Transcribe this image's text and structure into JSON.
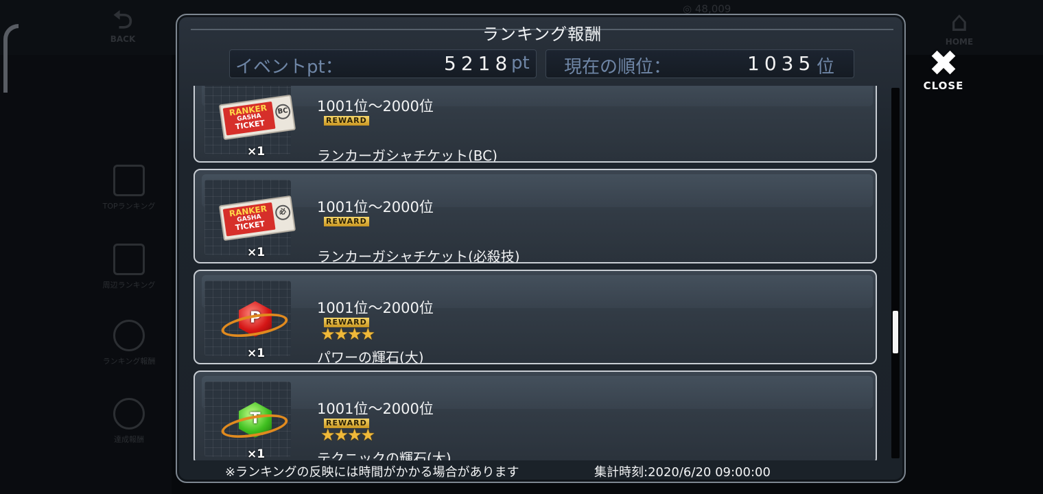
{
  "background": {
    "back_label": "BACK",
    "home_label": "HOME",
    "money_text": "48,009",
    "side_items": [
      {
        "label": "TOPランキング"
      },
      {
        "label": "周辺ランキング"
      },
      {
        "label": "ランキング報酬"
      },
      {
        "label": "達成報酬"
      }
    ]
  },
  "modal": {
    "title": "ランキング報酬",
    "event_pt": {
      "label": "イベントpt：",
      "value": "5218",
      "unit": "pt"
    },
    "current_rank": {
      "label": "現在の順位：",
      "value": "1035",
      "unit": "位"
    },
    "rewards": [
      {
        "rank_range": "1001位～2000位",
        "badge": "REWARD",
        "stars": "",
        "name": "ランカーガシャチケット(BC)",
        "qty": "×1",
        "icon": "ranker-ticket-bc-icon",
        "ticket_line1": "RANKER",
        "ticket_line2": "GASHA",
        "ticket_line3": "TICKET",
        "stamp": "BC"
      },
      {
        "rank_range": "1001位～2000位",
        "badge": "REWARD",
        "stars": "",
        "name": "ランカーガシャチケット(必殺技)",
        "qty": "×1",
        "icon": "ranker-ticket-special-icon",
        "ticket_line1": "RANKER",
        "ticket_line2": "GASHA",
        "ticket_line3": "TICKET",
        "stamp": "必"
      },
      {
        "rank_range": "1001位～2000位",
        "badge": "REWARD",
        "stars": "★★★★",
        "name": "パワーの輝石(大)",
        "qty": "×1",
        "icon": "power-gem-icon",
        "gem_letter": "P"
      },
      {
        "rank_range": "1001位～2000位",
        "badge": "REWARD",
        "stars": "★★★★",
        "name": "テクニックの輝石(大)",
        "qty": "×1",
        "icon": "technique-gem-icon",
        "gem_letter": "T"
      }
    ],
    "scroll_position": 0.68,
    "note": "※ランキングの反映には時間がかかる場合があります",
    "timestamp": "集計時刻:2020/6/20 09:00:00"
  },
  "close_label": "CLOSE",
  "colors": {
    "accent_label": "#6f86a6",
    "star": "#f0b93a",
    "ticket_red": "#d62f2a"
  }
}
